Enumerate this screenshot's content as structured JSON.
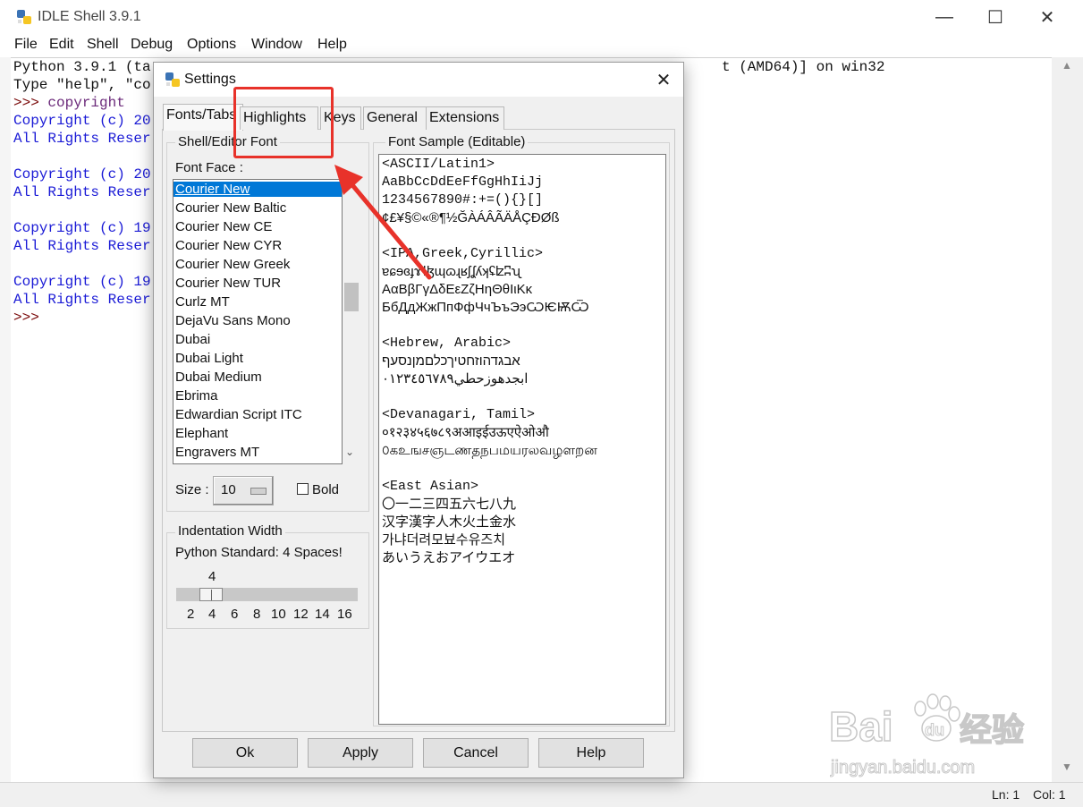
{
  "shell": {
    "title": "IDLE Shell 3.9.1",
    "menu": [
      "File",
      "Edit",
      "Shell",
      "Debug",
      "Options",
      "Window",
      "Help"
    ],
    "lines": [
      {
        "text": "Python 3.9.1 (ta",
        "tail": "t (AMD64)] on win32",
        "cls": "c-default"
      },
      {
        "text": "Type \"help\", \"co",
        "cls": "c-default"
      },
      {
        "prompt": ">>> ",
        "text": "copyright",
        "cls": "c-purple"
      },
      {
        "text": "Copyright (c) 20",
        "cls": "c-blue"
      },
      {
        "text": "All Rights Reser",
        "cls": "c-blue"
      },
      {
        "text": "",
        "cls": "c-blue"
      },
      {
        "text": "Copyright (c) 20",
        "cls": "c-blue"
      },
      {
        "text": "All Rights Reser",
        "cls": "c-blue"
      },
      {
        "text": "",
        "cls": "c-blue"
      },
      {
        "text": "Copyright (c) 19",
        "cls": "c-blue"
      },
      {
        "text": "All Rights Reser",
        "cls": "c-blue"
      },
      {
        "text": "",
        "cls": "c-blue"
      },
      {
        "text": "Copyright (c) 19",
        "cls": "c-blue"
      },
      {
        "text": "All Rights Reser",
        "cls": "c-blue"
      },
      {
        "prompt": ">>>",
        "text": "",
        "cls": "c-prompt"
      }
    ],
    "status": {
      "line": "Ln: 1",
      "col": "Col: 1"
    }
  },
  "settings": {
    "title": "Settings",
    "tabs": [
      "Fonts/Tabs",
      "Highlights",
      "Keys",
      "General",
      "Extensions"
    ],
    "active_tab": "Fonts/Tabs",
    "font_group_label": "Shell/Editor Font",
    "font_face_label": "Font Face :",
    "font_list": [
      "Courier New",
      "Courier New Baltic",
      "Courier New CE",
      "Courier New CYR",
      "Courier New Greek",
      "Courier New TUR",
      "Curlz MT",
      "DejaVu Sans Mono",
      "Dubai",
      "Dubai Light",
      "Dubai Medium",
      "Ebrima",
      "Edwardian Script ITC",
      "Elephant",
      "Engravers MT"
    ],
    "selected_font": "Courier New",
    "size_label": "Size :",
    "size_value": "10",
    "bold_label": "Bold",
    "bold_checked": false,
    "indent_group_label": "Indentation Width",
    "indent_note": "Python Standard: 4 Spaces!",
    "indent_value": "4",
    "indent_ticks": [
      "2",
      "4",
      "6",
      "8",
      "10",
      "12",
      "14",
      "16"
    ],
    "sample_group_label": "Font Sample (Editable)",
    "sample_lines": [
      {
        "text": "<ASCII/Latin1>",
        "mono": true
      },
      {
        "text": "AaBbCcDdEeFfGgHhIiJj",
        "mono": true
      },
      {
        "text": "1234567890#:+=(){}[]",
        "mono": true
      },
      {
        "text": "¢£¥§©«®¶½ĞÀÁÂÃÄÅÇÐØß",
        "mono": false
      },
      {
        "text": "",
        "mono": true
      },
      {
        "text": "<IPA,Greek,Cyrillic>",
        "mono": true
      },
      {
        "text": "ɐɕɘɞɟɤɫɮɰɷɻʁʃʆʎʞʢʫʭʯ",
        "mono": false
      },
      {
        "text": "ΑαΒβΓγΔδΕεΖζΗηΘθΙιΚκ",
        "mono": false
      },
      {
        "text": "БбДдЖжПпФфЧчЪъЭэѠѤѬѾ",
        "mono": false
      },
      {
        "text": "",
        "mono": true
      },
      {
        "text": "<Hebrew, Arabic>",
        "mono": true
      },
      {
        "text": "אבגדהוזחטיךכלםמןנסעף",
        "mono": false
      },
      {
        "text": "ابجدهوزحطي٠١٢٣٤٥٦٧٨٩",
        "mono": false
      },
      {
        "text": "",
        "mono": true
      },
      {
        "text": "<Devanagari, Tamil>",
        "mono": true
      },
      {
        "text": "०१२३४५६७८९अआइईउऊएऐओऔ",
        "mono": false
      },
      {
        "text": "௦கஉஙசஞடணதநபமயரலவழளறன",
        "mono": false
      },
      {
        "text": "",
        "mono": true
      },
      {
        "text": "<East Asian>",
        "mono": true
      },
      {
        "text": "〇一二三四五六七八九",
        "mono": false
      },
      {
        "text": "汉字漢字人木火土金水",
        "mono": false
      },
      {
        "text": "가냐더려모뵤수유즈치",
        "mono": false
      },
      {
        "text": "あいうえおアイウエオ",
        "mono": false
      }
    ],
    "buttons": [
      "Ok",
      "Apply",
      "Cancel",
      "Help"
    ]
  },
  "annotation": {
    "color": "#e8322a"
  },
  "watermark": {
    "brand": "Bai",
    "paw": "du",
    "cn": "经验",
    "url": "jingyan.baidu.com"
  }
}
